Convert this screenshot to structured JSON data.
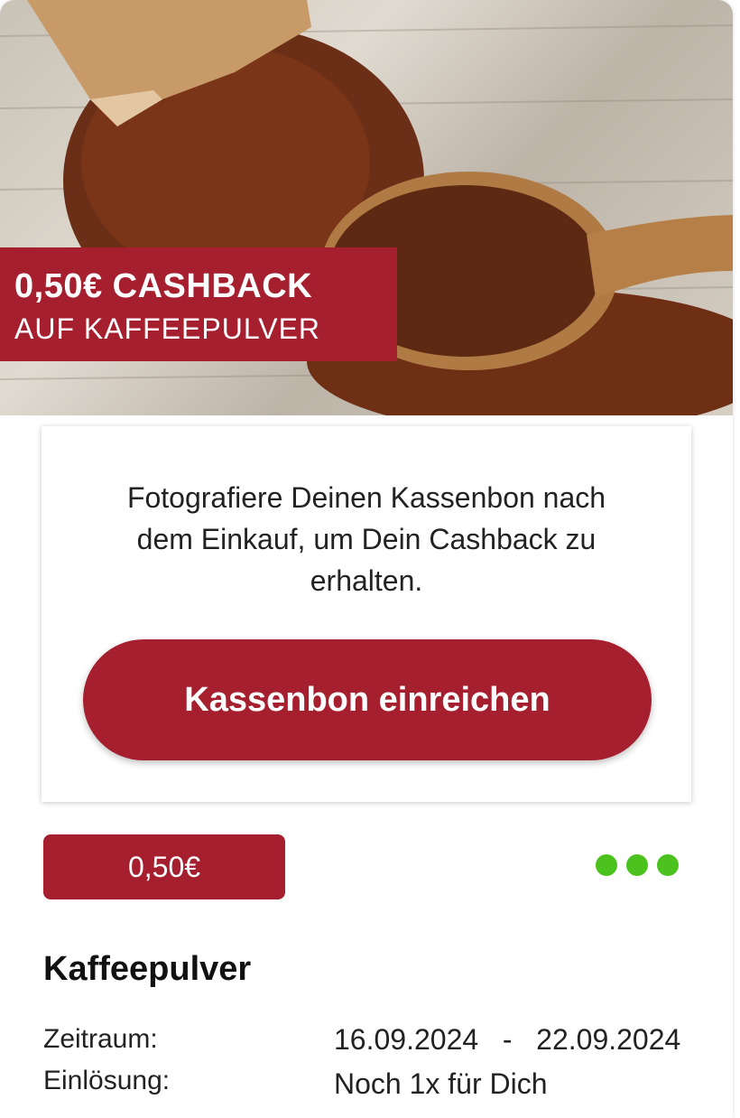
{
  "banner": {
    "line1": "0,50€ CASHBACK",
    "line2": "AUF KAFFEEPULVER"
  },
  "info": {
    "text": "Fotografiere Deinen Kassenbon nach dem Einkauf, um Dein Cashback zu erhalten.",
    "button_label": "Kassenbon einreichen"
  },
  "offer": {
    "amount": "0,50€",
    "product": "Kaffeepulver",
    "period_label": "Zeitraum:",
    "period_value": "16.09.2024   -   22.09.2024",
    "redemption_label": "Einlösung:",
    "redemption_value": "Noch 1x für Dich"
  },
  "colors": {
    "brand": "#a61f2f",
    "status_dots": "#4cc21f"
  }
}
